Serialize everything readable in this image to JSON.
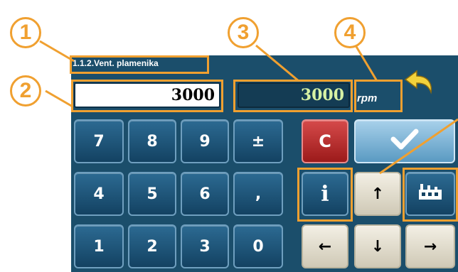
{
  "header": {
    "title": "1.1.2.Vent. plamenika"
  },
  "entry": {
    "value": "3000"
  },
  "current": {
    "value": "3000"
  },
  "unit": {
    "label": "rpm"
  },
  "keypad": {
    "row1": [
      "7",
      "8",
      "9",
      "±"
    ],
    "row2": [
      "4",
      "5",
      "6",
      ","
    ],
    "row3": [
      "1",
      "2",
      "3",
      "0"
    ]
  },
  "controls": {
    "clear": "C",
    "info": "i",
    "up": "↑",
    "left": "←",
    "down": "↓",
    "right": "→"
  },
  "callouts": {
    "one": "1",
    "two": "2",
    "three": "3",
    "four": "4"
  },
  "colors": {
    "accent": "#f0a030",
    "panel": "#1b4e6b"
  }
}
